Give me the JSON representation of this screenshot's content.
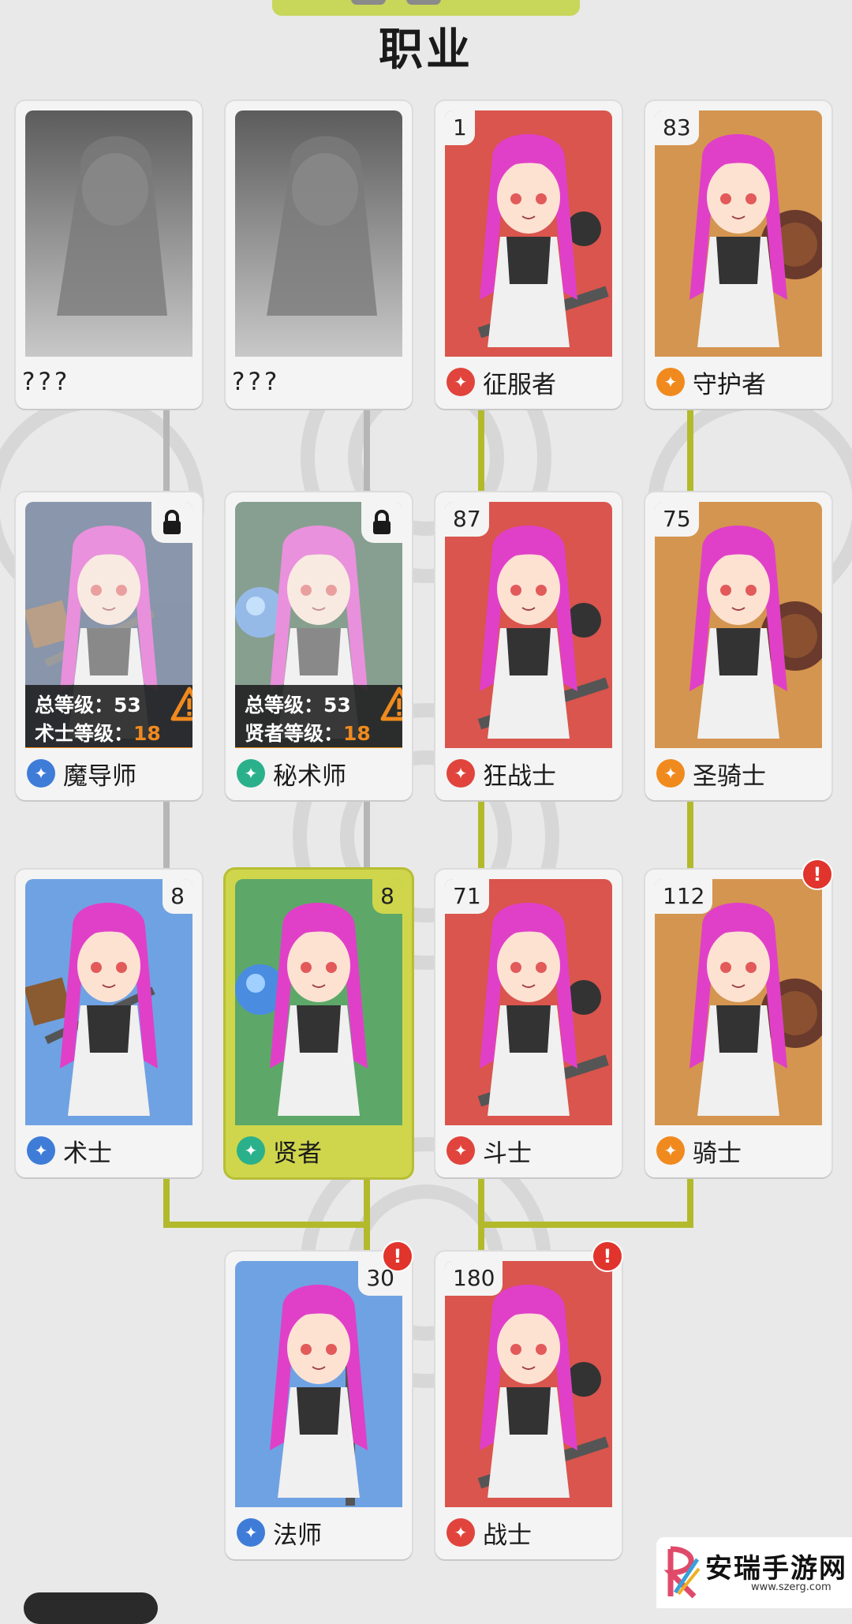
{
  "title": "职业",
  "cards": [
    {
      "id": "unknown-1",
      "number": "",
      "name": "???",
      "locked": false,
      "bg": "#5a5a5a",
      "type": "silhouette"
    },
    {
      "id": "unknown-2",
      "number": "",
      "name": "???",
      "locked": false,
      "bg": "#5a5a5a",
      "type": "silhouette"
    },
    {
      "id": "conqueror",
      "number": "1",
      "name": "征服者",
      "icon_color": "#e0443c",
      "bg": "#d9554d"
    },
    {
      "id": "guardian",
      "number": "83",
      "name": "守护者",
      "icon_color": "#f08a1e",
      "bg": "#d49550"
    },
    {
      "id": "archmage",
      "name": "魔导师",
      "icon_color": "#3e7cd8",
      "bg": "#33496f",
      "locked": true,
      "total_level_label": "总等级：53",
      "class_level_label": "术士等级：",
      "class_level_value": "18"
    },
    {
      "id": "arcanist",
      "name": "秘术师",
      "icon_color": "#2bb08c",
      "bg": "#2f5a3e",
      "locked": true,
      "total_level_label": "总等级：53",
      "class_level_label": "贤者等级：",
      "class_level_value": "18"
    },
    {
      "id": "berserker",
      "number": "87",
      "name": "狂战士",
      "icon_color": "#e0443c",
      "bg": "#d9554d"
    },
    {
      "id": "paladin",
      "number": "75",
      "name": "圣骑士",
      "icon_color": "#f08a1e",
      "bg": "#d49550"
    },
    {
      "id": "warlock",
      "number": "8",
      "name": "术士",
      "icon_color": "#3e7cd8",
      "bg": "#6fa2e2"
    },
    {
      "id": "sage",
      "number": "8",
      "name": "贤者",
      "icon_color": "#2bb08c",
      "bg": "#5da868",
      "selected": true
    },
    {
      "id": "fighter",
      "number": "71",
      "name": "斗士",
      "icon_color": "#e0443c",
      "bg": "#d9554d"
    },
    {
      "id": "knight",
      "number": "112",
      "name": "骑士",
      "icon_color": "#f08a1e",
      "bg": "#d49550",
      "alert": true
    },
    {
      "id": "mage",
      "number": "30",
      "name": "法师",
      "icon_color": "#3e7cd8",
      "bg": "#6fa2e2",
      "alert": true
    },
    {
      "id": "warrior",
      "number": "180",
      "name": "战士",
      "icon_color": "#e0443c",
      "bg": "#d9554d",
      "alert": true
    }
  ],
  "watermark": {
    "text": "安瑞手游网",
    "url": "www.szerg.com"
  },
  "colors": {
    "red": "#e0443c",
    "orange": "#f08a1e",
    "blue": "#3e7cd8",
    "teal": "#2bb08c",
    "selected": "#cfd64c",
    "line_green": "#b2ba2c",
    "line_gray": "#b6b6b6"
  }
}
